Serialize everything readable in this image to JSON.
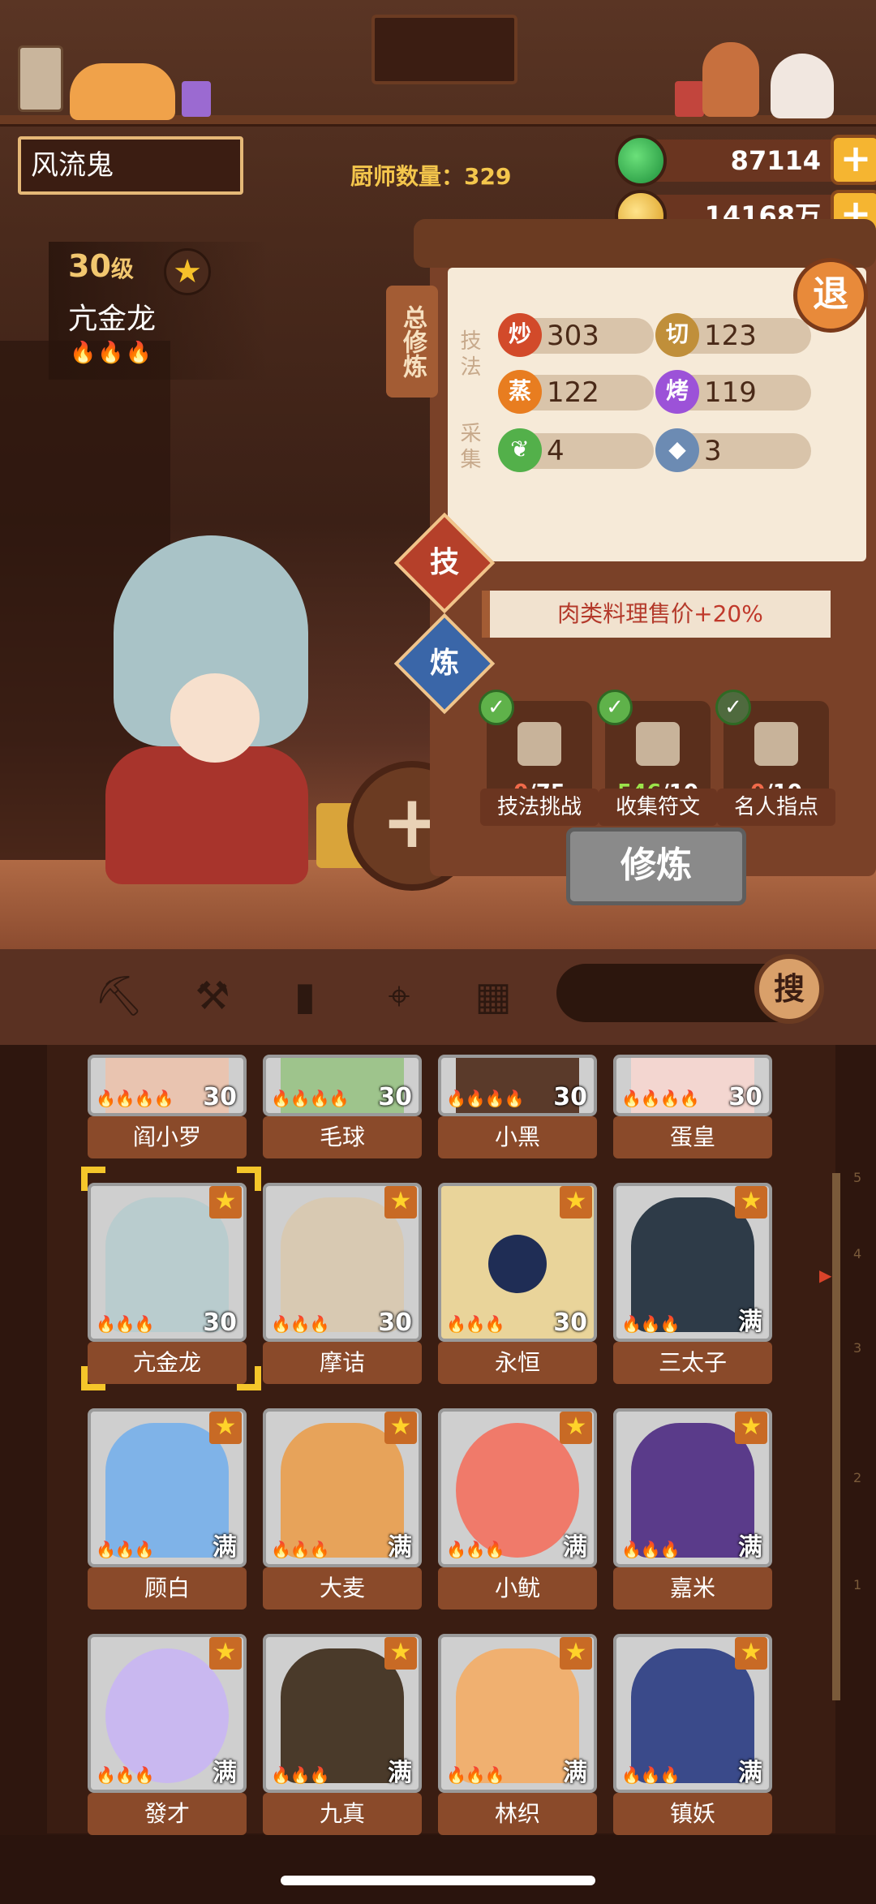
{
  "player": {
    "name": "风流鬼"
  },
  "header": {
    "chef_count_label": "厨师数量：",
    "chef_count": "329"
  },
  "currencies": [
    {
      "name": "jade",
      "value": "87114"
    },
    {
      "name": "gold",
      "value": "14168万"
    }
  ],
  "character": {
    "level": "30",
    "level_suffix": "级",
    "name": "亢金龙",
    "flames": "🔥🔥🔥"
  },
  "panel": {
    "tab_total": "总修炼",
    "skill_label": "技法",
    "gather_label": "采集",
    "exit_label": "退",
    "stats": [
      {
        "icon": "炒",
        "value": "303"
      },
      {
        "icon": "切",
        "value": "123"
      },
      {
        "icon": "蒸",
        "value": "122"
      },
      {
        "icon": "烤",
        "value": "119"
      },
      {
        "icon": "vegetable-icon",
        "value": "4"
      },
      {
        "icon": "fish-icon",
        "value": "3"
      }
    ],
    "tab_skill": "技",
    "tab_refine": "炼",
    "bonus": {
      "text": "肉类料理售价",
      "value": "+20%"
    },
    "tasks": [
      {
        "label": "技法挑战",
        "current": "0",
        "total": "/75"
      },
      {
        "label": "收集符文",
        "current": "546",
        "total": "/10"
      },
      {
        "label": "名人指点",
        "current": "0",
        "total": "/10"
      }
    ],
    "cultivate_button": "修炼"
  },
  "filters": {
    "search_label": "搜",
    "icons": [
      "shovel-icon",
      "shovel-alt-icon",
      "jar-icon",
      "location-pin-icon",
      "map-icon"
    ]
  },
  "rail_marks": [
    "5",
    "4",
    "3",
    "2",
    "1"
  ],
  "chefs_row0": [
    {
      "name": "阎小罗",
      "level": "30",
      "flames": "🔥🔥🔥🔥",
      "color": "#e9c4b0"
    },
    {
      "name": "毛球",
      "level": "30",
      "flames": "🔥🔥🔥🔥",
      "color": "#9ec48c"
    },
    {
      "name": "小黑",
      "level": "30",
      "flames": "🔥🔥🔥🔥",
      "color": "#5a3a2a"
    },
    {
      "name": "蛋皇",
      "level": "30",
      "flames": "🔥🔥🔥🔥",
      "color": "#f3d6d0"
    }
  ],
  "chefs_row1": [
    {
      "name": "亢金龙",
      "level": "30",
      "flames": "🔥🔥🔥",
      "star": "★",
      "color": "#b9ccce"
    },
    {
      "name": "摩诘",
      "level": "30",
      "flames": "🔥🔥🔥",
      "star": "★",
      "color": "#d8c9b2"
    },
    {
      "name": "永恒",
      "level": "30",
      "flames": "🔥🔥🔥",
      "star": "★",
      "color": "#1f2d55"
    },
    {
      "name": "三太子",
      "level": "满",
      "flames": "🔥🔥🔥",
      "star": "★",
      "color": "#2e3b48"
    }
  ],
  "chefs_row2": [
    {
      "name": "顾白",
      "level": "满",
      "flames": "🔥🔥🔥",
      "star": "★",
      "color": "#7fb3e8"
    },
    {
      "name": "大麦",
      "level": "满",
      "flames": "🔥🔥🔥",
      "star": "★",
      "color": "#e7a35a"
    },
    {
      "name": "小鱿",
      "level": "满",
      "flames": "🔥🔥🔥",
      "star": "★",
      "color": "#f07a6a"
    },
    {
      "name": "嘉米",
      "level": "满",
      "flames": "🔥🔥🔥",
      "star": "★",
      "color": "#5a3b8a"
    }
  ],
  "chefs_row3": [
    {
      "name": "發才",
      "level": "满",
      "flames": "🔥🔥🔥",
      "star": "★",
      "color": "#c9b8f0"
    },
    {
      "name": "九真",
      "level": "满",
      "flames": "🔥🔥🔥",
      "star": "★",
      "color": "#4a3a2a"
    },
    {
      "name": "林织",
      "level": "满",
      "flames": "🔥🔥🔥",
      "star": "★",
      "color": "#f0b070"
    },
    {
      "name": "镇妖",
      "level": "满",
      "flames": "🔥🔥🔥",
      "star": "★",
      "color": "#3a4a8a"
    }
  ]
}
